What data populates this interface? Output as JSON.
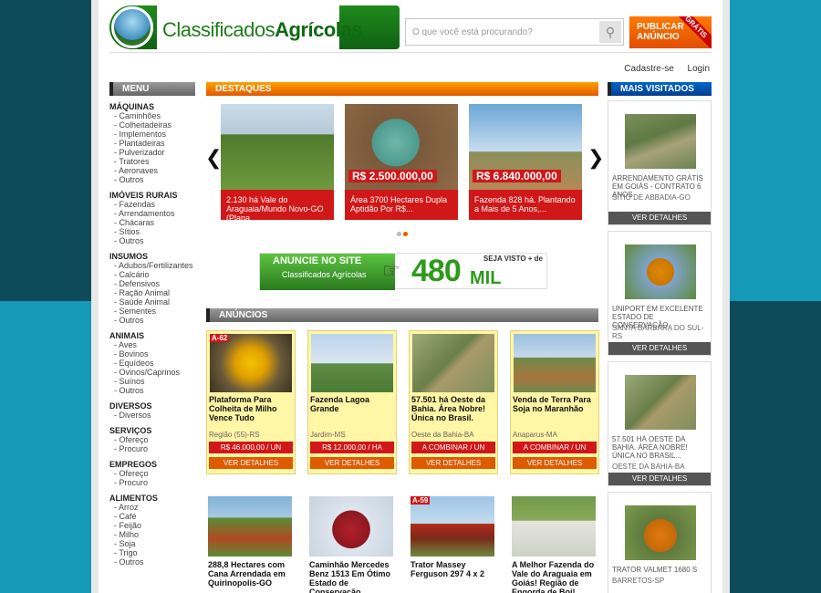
{
  "header": {
    "logo_part1": "Classificados",
    "logo_part2": "Agrícolas",
    "search_placeholder": "O que você está procurando?",
    "publish_label": "PUBLICAR ANÚNCIO",
    "publish_tag": "GRÁTIS",
    "signup": "Cadastre-se",
    "login": "Login"
  },
  "sidebar": {
    "title": "MENU",
    "categories": [
      {
        "name": "MÁQUINAS",
        "items": [
          "Caminhões",
          "Colheitadeiras",
          "Implementos",
          "Plantadeiras",
          "Pulverizador",
          "Tratores",
          "Aeronaves",
          "Outros"
        ]
      },
      {
        "name": "IMÓVEIS RURAIS",
        "items": [
          "Fazendas",
          "Arrendamentos",
          "Chácaras",
          "Sítios",
          "Outros"
        ]
      },
      {
        "name": "INSUMOS",
        "items": [
          "Adubos/Fertilizantes",
          "Calcário",
          "Defensivos",
          "Ração Animal",
          "Saúde Animal",
          "Sementes",
          "Outros"
        ]
      },
      {
        "name": "ANIMAIS",
        "items": [
          "Aves",
          "Bovinos",
          "Equídeos",
          "Ovinos/Caprinos",
          "Suínos",
          "Outros"
        ]
      },
      {
        "name": "DIVERSOS",
        "items": [
          "Diversos"
        ]
      },
      {
        "name": "SERVIÇOS",
        "items": [
          "Ofereço",
          "Procuro"
        ]
      },
      {
        "name": "EMPREGOS",
        "items": [
          "Ofereço",
          "Procuro"
        ]
      },
      {
        "name": "ALIMENTOS",
        "items": [
          "Arroz",
          "Café",
          "Feijão",
          "Milho",
          "Soja",
          "Trigo",
          "Outros"
        ]
      }
    ]
  },
  "destaques": {
    "title": "DESTAQUES",
    "cards": [
      {
        "text": "2.130 há Vale do Araguaia/Mundo Novo-GO (Plana...",
        "price": ""
      },
      {
        "text": "Área 3700 Hectares Dupla Aptidão Por R$...",
        "price": "R$ 2.500.000,00"
      },
      {
        "text": "Fazenda 828 há. Plantando a Mais de 5 Anos,...",
        "price": "R$ 6.840.000,00"
      }
    ]
  },
  "banner": {
    "text1": "ANUNCIE NO SITE",
    "text2": "Classificados Agrícolas",
    "seja": "SEJA VISTO + de",
    "number": "480",
    "unit": "MIL"
  },
  "anuncios": {
    "title": "ANÚNCIOS",
    "ads": [
      {
        "tag": "A-62",
        "title": "Plataforma Para Colheita de Milho Vence Tudo",
        "location": "Região (55)-RS",
        "price": "R$ 46.000,00 / UN",
        "details": "VER DETALHES"
      },
      {
        "tag": "",
        "title": "Fazenda Lagoa Grande",
        "location": "Jardim-MS",
        "price": "R$ 12.000,00 / HA",
        "details": "VER DETALHES"
      },
      {
        "tag": "",
        "title": "57.501 há Oeste da Bahia. Área Nobre! Única no Brasil.",
        "location": "Oeste da Bahia-BA",
        "price": "A COMBINAR / UN",
        "details": "VER DETALHES"
      },
      {
        "tag": "",
        "title": "Venda de Terra Para Soja no Maranhão",
        "location": "Anaparus-MA",
        "price": "A COMBINAR / UN",
        "details": "VER DETALHES"
      }
    ],
    "ads_row2": [
      {
        "tag": "",
        "title": "288,8 Hectares com Cana Arrendada em Quirinopolis-GO"
      },
      {
        "tag": "",
        "title": "Caminhão Mercedes Benz 1513 Em Ótimo Estado de Conservação"
      },
      {
        "tag": "A-59",
        "title": "Trator Massey Ferguson 297 4 x 2"
      },
      {
        "tag": "",
        "title": "A Melhor Fazenda do Vale do Araguaia em Goiás! Região de Engorda de Boi!"
      }
    ]
  },
  "visitados": {
    "title": "MAIS VISITADOS",
    "items": [
      {
        "title": "ARRENDAMENTO GRÁTIS EM GOIÁS - CONTRATO 6 ANOS",
        "location": "SÍTIO DE ABBADIA-GO",
        "button": "VER DETALHES"
      },
      {
        "title": "UNIPORT EM EXCELENTE ESTADO DE CONSERVAÇÃO",
        "location": "SANTA BÁRBARA DO SUL-RS",
        "button": "VER DETALHES"
      },
      {
        "title": "57.501 HÁ OESTE DA BAHIA. ÁREA NOBRE! ÚNICA NO BRASIL...",
        "location": "OESTE DA BAHIA-BA",
        "button": "VER DETALHES"
      },
      {
        "title": "TRATOR VALMET 1680 S",
        "location": "BARRETOS-SP",
        "button": ""
      }
    ]
  }
}
